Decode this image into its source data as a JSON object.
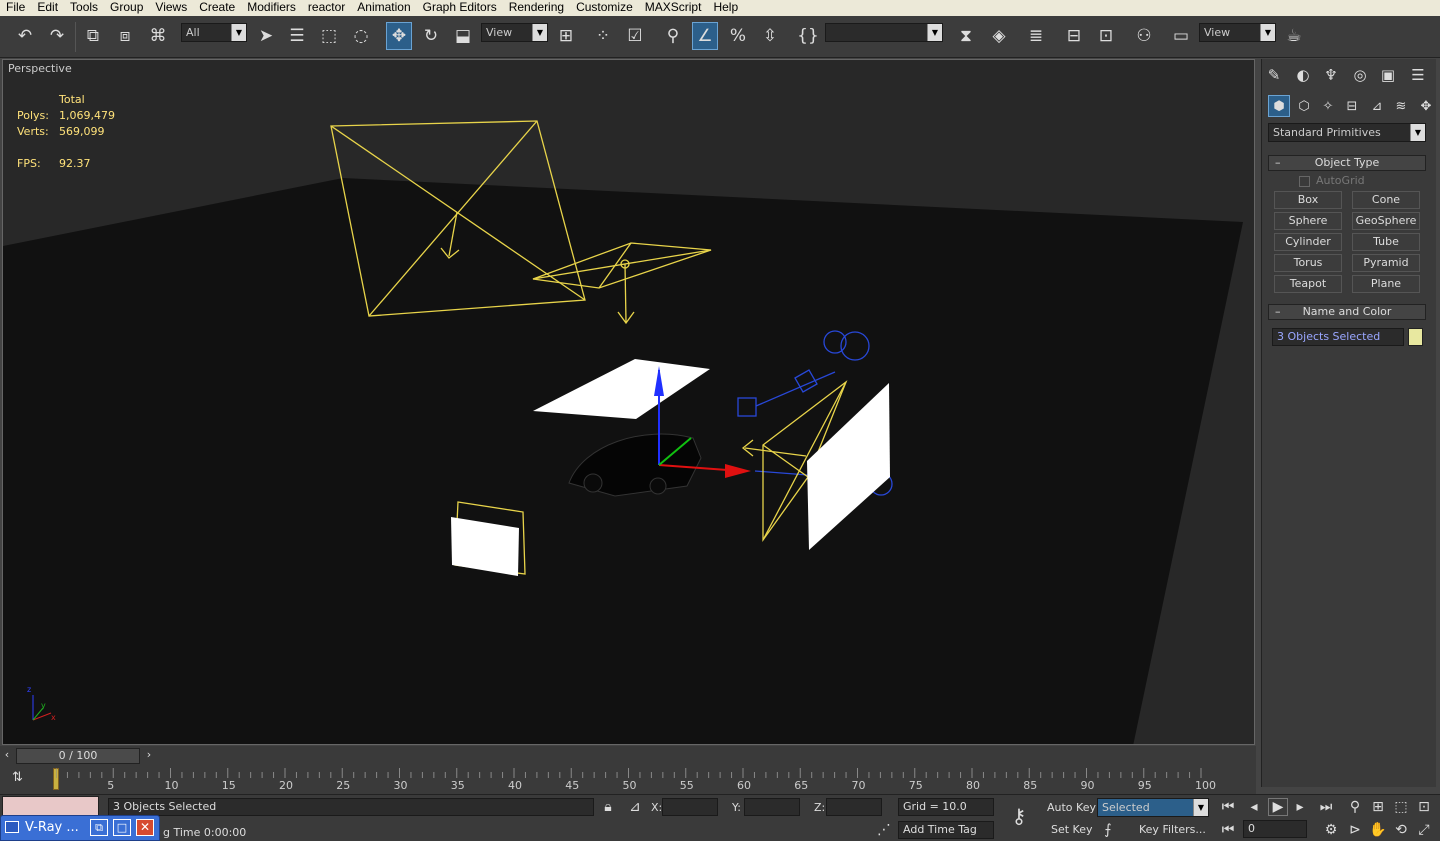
{
  "menu": [
    "File",
    "Edit",
    "Tools",
    "Group",
    "Views",
    "Create",
    "Modifiers",
    "reactor",
    "Animation",
    "Graph Editors",
    "Rendering",
    "Customize",
    "MAXScript",
    "Help"
  ],
  "toolbar": {
    "selection_filter": "All",
    "ref_coord": "View",
    "named_sel": "",
    "view2": "View"
  },
  "viewport": {
    "label": "Perspective",
    "stats_header": "Total",
    "polys_label": "Polys:",
    "polys": "1,069,479",
    "verts_label": "Verts:",
    "verts": "569,099",
    "fps_label": "FPS:",
    "fps": "92.37"
  },
  "command_panel": {
    "category": "Standard Primitives",
    "object_type_title": "Object Type",
    "autogrid": "AutoGrid",
    "buttons": [
      "Box",
      "Cone",
      "Sphere",
      "GeoSphere",
      "Cylinder",
      "Tube",
      "Torus",
      "Pyramid",
      "Teapot",
      "Plane"
    ],
    "name_color_title": "Name and Color",
    "name_value": "3 Objects Selected",
    "swatch_color": "#e8e8a0"
  },
  "timeline": {
    "frame": "0 / 100",
    "ticks": [
      "5",
      "10",
      "15",
      "20",
      "25",
      "30",
      "35",
      "40",
      "45",
      "50",
      "55",
      "60",
      "65",
      "70",
      "75",
      "80",
      "85",
      "90",
      "95",
      "100"
    ]
  },
  "status": {
    "selection": "3 Objects Selected",
    "x_label": "X:",
    "y_label": "Y:",
    "z_label": "Z:",
    "grid": "Grid = 10.0",
    "auto_key": "Auto Key",
    "key_mode": "Selected",
    "set_key": "Set Key",
    "key_filters": "Key Filters...",
    "time": "g Time  0:00:00",
    "add_time_tag": "Add Time Tag",
    "frame": "0"
  },
  "taskbar": {
    "label": "V-Ray ..."
  }
}
